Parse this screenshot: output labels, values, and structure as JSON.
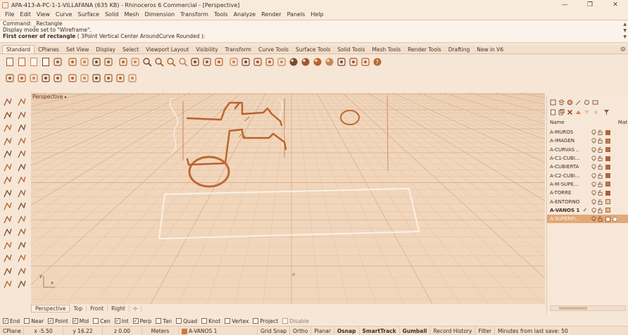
{
  "titlebar": {
    "title": "APA-413-A-PC-1-1-VILLAFANA (635 KB) - Rhinoceros 6 Commercial - [Perspective]",
    "minimize": "—",
    "maximize": "❐",
    "close": "✕"
  },
  "menu": [
    "File",
    "Edit",
    "View",
    "Curve",
    "Surface",
    "Solid",
    "Mesh",
    "Dimension",
    "Transform",
    "Tools",
    "Analyze",
    "Render",
    "Panels",
    "Help"
  ],
  "command": {
    "history1": "Command: _Rectangle",
    "history2": "Display mode set to \"Wireframe\".",
    "prompt": "First corner of rectangle",
    "options": " ( 3Point  Vertical  Center  AroundCurve  Rounded ): "
  },
  "toolbar_tabs": [
    "Standard",
    "CPlanes",
    "Set View",
    "Display",
    "Select",
    "Viewport Layout",
    "Visibility",
    "Transform",
    "Curve Tools",
    "Surface Tools",
    "Solid Tools",
    "Mesh Tools",
    "Render Tools",
    "Drafting",
    "New in V6"
  ],
  "active_tab": "Standard",
  "viewport": {
    "name": "Perspective",
    "axis_x": "x",
    "axis_y": "y"
  },
  "view_tabs": [
    "Perspective",
    "Top",
    "Front",
    "Right"
  ],
  "view_tabs_add": "⊹",
  "layers": {
    "header_name": "Name",
    "header_mat": "Mat",
    "items": [
      {
        "name": "A-MUROS",
        "current": false,
        "selected": false,
        "color": "#b8642c"
      },
      {
        "name": "A-IMAGEN",
        "current": false,
        "selected": false,
        "color": "#c8784a"
      },
      {
        "name": "A-CURVAS ...",
        "current": false,
        "selected": false,
        "color": "#c06a34"
      },
      {
        "name": "A-C1-CUBI...",
        "current": false,
        "selected": false,
        "color": "#b85a2a"
      },
      {
        "name": "A-CUBIERTA",
        "current": false,
        "selected": false,
        "color": "#c06430"
      },
      {
        "name": "A-C2-CUBI...",
        "current": false,
        "selected": false,
        "color": "#b46236"
      },
      {
        "name": "A-M-SUPE...",
        "current": false,
        "selected": false,
        "color": "#c47040"
      },
      {
        "name": "A-TORRE",
        "current": false,
        "selected": false,
        "color": "#b05a30"
      },
      {
        "name": "A-ENTORNO",
        "current": false,
        "selected": false,
        "color": "#e8c8aa"
      },
      {
        "name": "A-VANOS 1",
        "current": true,
        "selected": false,
        "color": "#e6b892"
      },
      {
        "name": "A-SUPERFI...",
        "current": false,
        "selected": true,
        "color": "#fbeee2"
      }
    ]
  },
  "osnaps": [
    {
      "label": "End",
      "checked": true,
      "disabled": false
    },
    {
      "label": "Near",
      "checked": false,
      "disabled": false
    },
    {
      "label": "Point",
      "checked": true,
      "disabled": false
    },
    {
      "label": "Mid",
      "checked": true,
      "disabled": false
    },
    {
      "label": "Cen",
      "checked": false,
      "disabled": false
    },
    {
      "label": "Int",
      "checked": true,
      "disabled": false
    },
    {
      "label": "Perp",
      "checked": true,
      "disabled": false
    },
    {
      "label": "Tan",
      "checked": false,
      "disabled": false
    },
    {
      "label": "Quad",
      "checked": false,
      "disabled": false
    },
    {
      "label": "Knot",
      "checked": false,
      "disabled": false
    },
    {
      "label": "Vertex",
      "checked": false,
      "disabled": false
    },
    {
      "label": "Project",
      "checked": false,
      "disabled": false
    },
    {
      "label": "Disable",
      "checked": false,
      "disabled": true
    }
  ],
  "status": {
    "cplane": "CPlane",
    "x": "x -5.50",
    "y": "y 16.22",
    "z": "z 0.00",
    "units": "Meters",
    "layer": "A-VANOS 1",
    "grid_snap": "Grid Snap",
    "ortho": "Ortho",
    "planar": "Planar",
    "osnap": "Osnap",
    "smarttrack": "SmartTrack",
    "gumball": "Gumball",
    "record_history": "Record History",
    "filter": "Filter",
    "minutes": "Minutes from last save: 50"
  },
  "colors": {
    "accent": "#c8682c",
    "viewport_bg": "#f1d6bc",
    "selected_row": "#e2a878"
  }
}
